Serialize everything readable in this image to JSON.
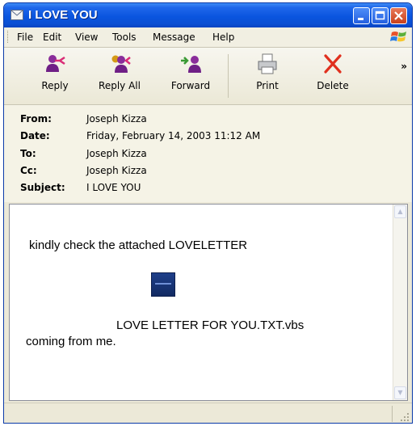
{
  "window": {
    "title": "I LOVE YOU"
  },
  "menu": {
    "file": "File",
    "edit": "Edit",
    "view": "View",
    "tools": "Tools",
    "message": "Message",
    "help": "Help"
  },
  "toolbar": {
    "reply": "Reply",
    "reply_all": "Reply All",
    "forward": "Forward",
    "print": "Print",
    "delete": "Delete",
    "more": "»"
  },
  "header": {
    "from_label": "From:",
    "from": "Joseph Kizza",
    "date_label": "Date:",
    "date": "Friday, February 14, 2003 11:12 AM",
    "to_label": "To:",
    "to": "Joseph Kizza",
    "cc_label": "Cc:",
    "cc": "Joseph Kizza",
    "subject_label": "Subject:",
    "subject": "I LOVE YOU"
  },
  "message": {
    "line1": "kindly check the attached LOVELETTER",
    "attachment_name": "LOVE LETTER FOR YOU.TXT.vbs",
    "line2": "coming from me."
  },
  "colors": {
    "titlebar": "#0a55df",
    "close_button": "#d9542b",
    "chrome": "#ece9d8"
  }
}
